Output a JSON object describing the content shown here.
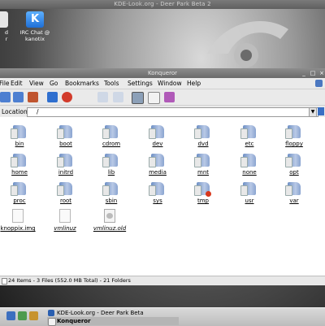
{
  "desktop": {
    "background_title": "KDE-Look.org - Deer Park Beta 2",
    "icons": [
      {
        "name": "irc-chat",
        "label_line1": "IRC Chat @",
        "label_line2": "kanotix",
        "glyph": "K"
      },
      {
        "name": "partial",
        "label_line1": "d",
        "label_line2": "r"
      }
    ]
  },
  "window": {
    "title": "Konqueror",
    "menu": [
      "File",
      "Edit",
      "View",
      "Go",
      "Bookmarks",
      "Tools",
      "Settings",
      "Window",
      "Help"
    ],
    "location_label": "Location:",
    "location_value": "/"
  },
  "files": [
    {
      "label": "bin",
      "type": "folder"
    },
    {
      "label": "boot",
      "type": "folder"
    },
    {
      "label": "cdrom",
      "type": "folder"
    },
    {
      "label": "dev",
      "type": "folder"
    },
    {
      "label": "dvd",
      "type": "folder"
    },
    {
      "label": "etc",
      "type": "folder"
    },
    {
      "label": "floppy",
      "type": "folder"
    },
    {
      "label": "home",
      "type": "folder"
    },
    {
      "label": "initrd",
      "type": "folder"
    },
    {
      "label": "lib",
      "type": "folder"
    },
    {
      "label": "media",
      "type": "folder"
    },
    {
      "label": "mnt",
      "type": "folder"
    },
    {
      "label": "none",
      "type": "folder"
    },
    {
      "label": "opt",
      "type": "folder"
    },
    {
      "label": "proc",
      "type": "folder"
    },
    {
      "label": "root",
      "type": "folder"
    },
    {
      "label": "sbin",
      "type": "folder"
    },
    {
      "label": "sys",
      "type": "folder"
    },
    {
      "label": "tmp",
      "type": "folder",
      "badge": true
    },
    {
      "label": "usr",
      "type": "folder"
    },
    {
      "label": "var",
      "type": "folder"
    },
    {
      "label": "knoppix.img",
      "type": "file"
    },
    {
      "label": "vmlinuz",
      "type": "file",
      "italic": true
    },
    {
      "label": "vmlinuz.old",
      "type": "file-img",
      "italic": true
    }
  ],
  "status": "24 Items - 3 Files (552.0 MB Total) - 21 Folders",
  "taskbar": {
    "tasks": [
      {
        "label": "KDE-Look.org - Deer Park Beta",
        "color": "#2a5fb0"
      },
      {
        "label": "Konqueror",
        "color": "#f2f2f2"
      }
    ]
  },
  "colors": {
    "accent": "#3a6fc4",
    "folder": "#8aa4d0"
  }
}
